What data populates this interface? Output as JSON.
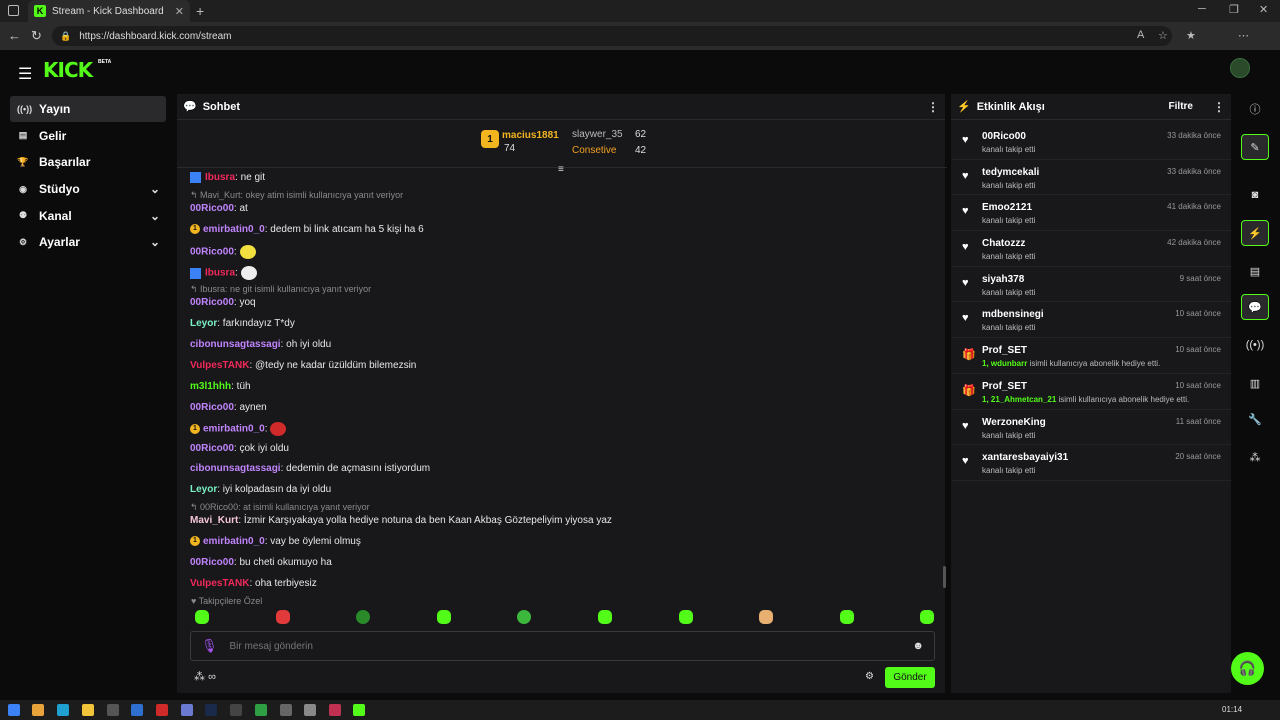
{
  "browser": {
    "tab_title": "Stream - Kick Dashboard",
    "favicon_letter": "K",
    "url": "https://dashboard.kick.com/stream"
  },
  "header": {
    "logo": "KICK",
    "beta": "BETA"
  },
  "sidebar": {
    "items": [
      {
        "label": "Yayın",
        "icon": "broadcast-icon"
      },
      {
        "label": "Gelir",
        "icon": "revenue-icon"
      },
      {
        "label": "Başarılar",
        "icon": "trophy-icon"
      },
      {
        "label": "Stüdyo",
        "icon": "studio-icon"
      },
      {
        "label": "Kanal",
        "icon": "channel-icon"
      },
      {
        "label": "Ayarlar",
        "icon": "gear-icon"
      }
    ]
  },
  "chat": {
    "title": "Sohbet",
    "leaderboard": {
      "first": {
        "rank": "1",
        "name": "macius1881",
        "count": "74"
      },
      "second": {
        "name": "slaywer_35",
        "count": "62"
      },
      "third": {
        "name": "Consetive",
        "count": "42"
      }
    },
    "messages": [
      {
        "user": "Ibusra",
        "text": ": ne git",
        "color": "#f2295a"
      },
      {
        "reply": "Mavi_Kurt: okey atim isimli kullanıcıya yanıt veriyor"
      },
      {
        "user": "00Rico00",
        "text": ": at",
        "color": "#c084fc"
      },
      {
        "user": "emirbatin0_0",
        "text": ": dedem bi link atıcam ha 5 kişi ha 6",
        "color": "#c084fc"
      },
      {
        "user": "00Rico00",
        "text": ":",
        "color": "#c084fc"
      },
      {
        "user": "Ibusra",
        "text": ":",
        "color": "#f2295a"
      },
      {
        "reply": "Ibusra: ne git isimli kullanıcıya yanıt veriyor"
      },
      {
        "user": "00Rico00",
        "text": ": yoq",
        "color": "#c084fc"
      },
      {
        "user": "Leyor",
        "text": ": farkındayız T*dy",
        "color": "#7cf2c4"
      },
      {
        "user": "cibonunsagtassagi",
        "text": ": oh iyi oldu",
        "color": "#c084fc"
      },
      {
        "user": "VulpesTANK",
        "text": ": @tedy ne kadar üzüldüm bilemezsin",
        "color": "#f2295a"
      },
      {
        "user": "m3l1hhh",
        "text": ": tüh",
        "color": "#53fc18"
      },
      {
        "user": "00Rico00",
        "text": ": aynen",
        "color": "#c084fc"
      },
      {
        "user": "emirbatin0_0",
        "text": ":",
        "color": "#c084fc"
      },
      {
        "user": "00Rico00",
        "text": ": çok iyi oldu",
        "color": "#c084fc"
      },
      {
        "user": "cibonunsagtassagi",
        "text": ": dedemin de açmasını istiyordum",
        "color": "#c084fc"
      },
      {
        "user": "Leyor",
        "text": ": iyi kolpadasın da iyi oldu",
        "color": "#7cf2c4"
      },
      {
        "reply": "00Rico00: at isimli kullanıcıya yanıt veriyor"
      },
      {
        "user": "Mavi_Kurt",
        "text": ": İzmir Karşıyakaya yolla hediye notuna da ben Kaan Akbaş Göztepeliyim yiyosa yaz",
        "color": "#f5c6d8"
      },
      {
        "user": "emirbatin0_0",
        "text": ": vay be öylemi olmuş",
        "color": "#c084fc"
      },
      {
        "user": "00Rico00",
        "text": ": bu cheti okumuyo ha",
        "color": "#c084fc"
      },
      {
        "user": "VulpesTANK",
        "text": ": oha terbiyesiz",
        "color": "#f2295a"
      }
    ],
    "follow_only": "♥ Takipçilere Özel",
    "input_placeholder": "Bir mesaj gönderin",
    "send_label": "Gönder",
    "infinity": "∞"
  },
  "activity": {
    "title": "Etkinlik Akışı",
    "filter": "Filtre",
    "events": [
      {
        "type": "follow",
        "name": "00Rico00",
        "desc": "kanalı takip etti",
        "time": "33 dakika önce"
      },
      {
        "type": "follow",
        "name": "tedymcekali",
        "desc": "kanalı takip etti",
        "time": "33 dakika önce"
      },
      {
        "type": "follow",
        "name": "Emoo2121",
        "desc": "kanalı takip etti",
        "time": "41 dakika önce"
      },
      {
        "type": "follow",
        "name": "Chatozzz",
        "desc": "kanalı takip etti",
        "time": "42 dakika önce"
      },
      {
        "type": "follow",
        "name": "siyah378",
        "desc": "kanalı takip etti",
        "time": "9 saat önce"
      },
      {
        "type": "follow",
        "name": "mdbensinegi",
        "desc": "kanalı takip etti",
        "time": "10 saat önce"
      },
      {
        "type": "gift",
        "name": "Prof_SET",
        "desc_green": "1, wdunbarr",
        "desc": " isimli kullanıcıya abonelik hediye etti.",
        "time": "10 saat önce"
      },
      {
        "type": "gift",
        "name": "Prof_SET",
        "desc_green": "1, 21_Ahmetcan_21",
        "desc": " isimli kullanıcıya abonelik hediye etti.",
        "time": "10 saat önce"
      },
      {
        "type": "follow",
        "name": "WerzoneKing",
        "desc": "kanalı takip etti",
        "time": "11 saat önce"
      },
      {
        "type": "follow",
        "name": "xantaresbayaiyi31",
        "desc": "kanalı takip etti",
        "time": "20 saat önce"
      }
    ]
  },
  "taskbar": {
    "time": "01:14"
  },
  "colors": {
    "accent": "#53fc18",
    "panel": "#18181b",
    "background": "#0b0b0c"
  }
}
